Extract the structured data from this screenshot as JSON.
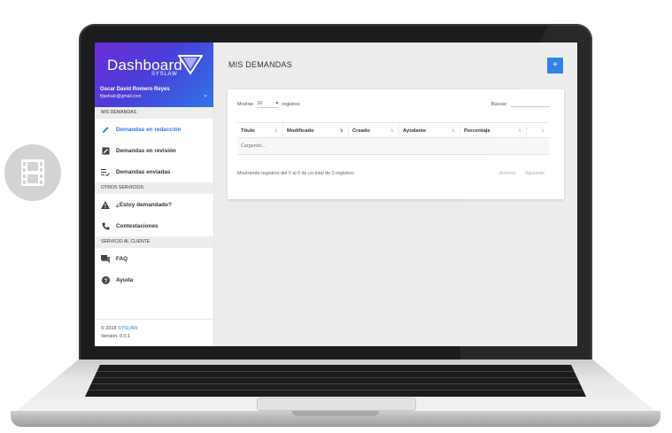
{
  "brand": {
    "title": "Dashboard",
    "sub": "SYSLAW"
  },
  "user": {
    "name": "Oscar David Romero Reyes",
    "email": "fijaobalo@gmail.com"
  },
  "sidebar": {
    "sections": [
      {
        "title": "MIS DEMANDAS",
        "items": [
          {
            "label": "Demandas en redacción",
            "icon": "pencil-icon",
            "active": true
          },
          {
            "label": "Demandas en revisión",
            "icon": "edit-box-icon",
            "active": false
          },
          {
            "label": "Demandas enviadas",
            "icon": "sent-list-icon",
            "active": false
          }
        ]
      },
      {
        "title": "OTROS SERVICIOS",
        "items": [
          {
            "label": "¿Estoy demandado?",
            "icon": "warning-icon",
            "active": false
          },
          {
            "label": "Contestaciones",
            "icon": "phone-icon",
            "active": false
          }
        ]
      },
      {
        "title": "SERVICIO AL CLIENTE",
        "items": [
          {
            "label": "FAQ",
            "icon": "forum-icon",
            "active": false
          },
          {
            "label": "Ayuda",
            "icon": "help-icon",
            "active": false
          }
        ]
      }
    ],
    "footer": {
      "copyright": "© 2018",
      "company": "SYSLAW.",
      "version": "Version: 0.0.1"
    }
  },
  "main": {
    "title": "MIS DEMANDAS",
    "add_label": "+",
    "length": {
      "prefix": "Mostrar",
      "value": "10",
      "suffix": "registros"
    },
    "search_label": "Buscar:",
    "columns": [
      "Título",
      "Modificado",
      "Creado",
      "Ayudante",
      "Porcentaje",
      ""
    ],
    "loading": "Cargando...",
    "info": "Mostrando registros del 0 al 0 de un total de 0 registros",
    "prev": "Anterior",
    "next": "Siguiente"
  },
  "colors": {
    "accent": "#2a7be4",
    "brand_start": "#6b2fd6",
    "brand_end": "#2f76e6"
  }
}
